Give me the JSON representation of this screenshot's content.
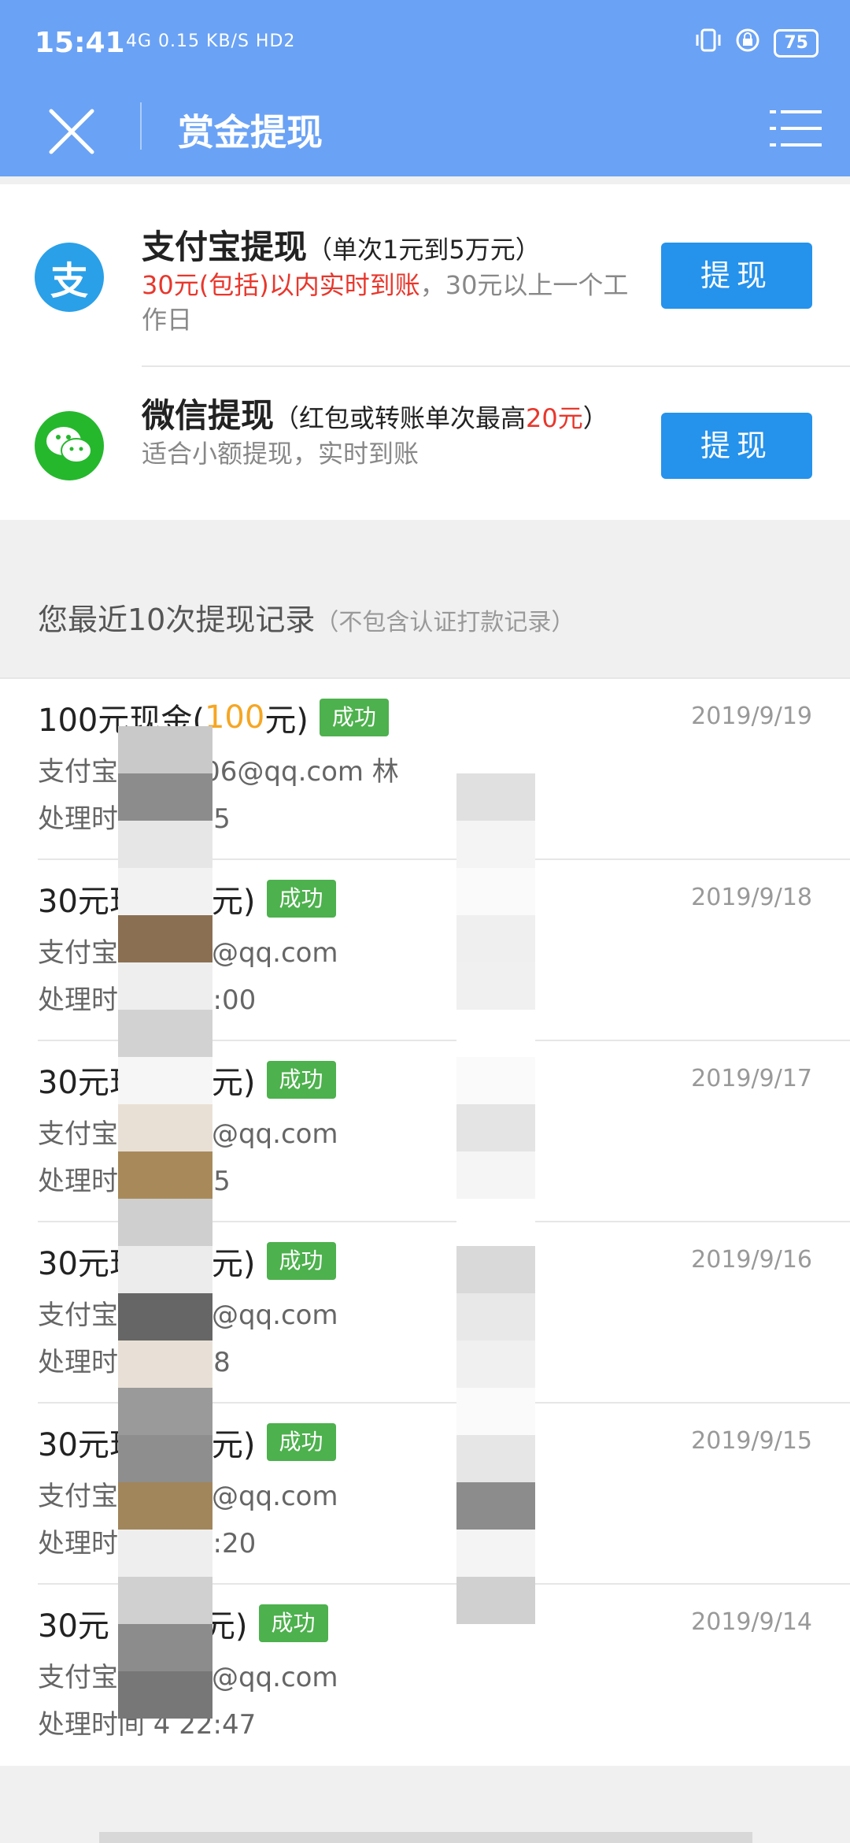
{
  "status_bar": {
    "time": "15:41",
    "network": "4G 0.15 KB/S HD2",
    "battery": "75"
  },
  "header": {
    "title": "赏金提现"
  },
  "methods": [
    {
      "name": "支付宝提现",
      "note": "（单次1元到5万元）",
      "desc_red": "30元(包括)以内实时到账",
      "desc_rest": "，30元以上一个工作日",
      "button": "提现",
      "logo_text": "支",
      "color": "#2aa0e8"
    },
    {
      "name": "微信提现",
      "note_pre": "（红包或转账单次最高",
      "note_red": "20元",
      "note_post": "）",
      "desc": "适合小额提现，实时到账",
      "button": "提现",
      "color": "#25b82d"
    }
  ],
  "records_heading": {
    "title": "您最近10次提现记录",
    "sub": "（不包含认证打款记录）"
  },
  "records": [
    {
      "title_pre": "100元现金(",
      "title_highlight": "100",
      "title_post": "元)",
      "status": "成功",
      "date": "2019/9/19",
      "account": "支付宝   1   67306@qq.com   林",
      "time": "处理时间   11:45"
    },
    {
      "title_pre": "30元现",
      "title_highlight": "",
      "title_post": "元)",
      "status": "成功",
      "date": "2019/9/18",
      "account": "支付宝   67306@qq.com",
      "time": "处理时间   8 15:00"
    },
    {
      "title_pre": "30元现",
      "title_highlight": "",
      "title_post": "元)",
      "status": "成功",
      "date": "2019/9/17",
      "account": "支付宝   67306@qq.com",
      "time": "处理时间   00:05"
    },
    {
      "title_pre": "30元现",
      "title_highlight": "",
      "title_post": "元)",
      "status": "成功",
      "date": "2019/9/16",
      "account": "支付宝   67306@qq.com",
      "time": "处理时间   00:08"
    },
    {
      "title_pre": "30元现",
      "title_highlight": "",
      "title_post": "元)",
      "status": "成功",
      "date": "2019/9/15",
      "account": "支付宝   67306@qq.com",
      "time": "处理时间   5 00:20"
    },
    {
      "title_pre": "30元",
      "title_highlight": "",
      "title_post": "元)",
      "status": "成功",
      "date": "2019/9/14",
      "account": "支付宝   67306@qq.com",
      "time": "处理时间   4 22:47"
    }
  ]
}
